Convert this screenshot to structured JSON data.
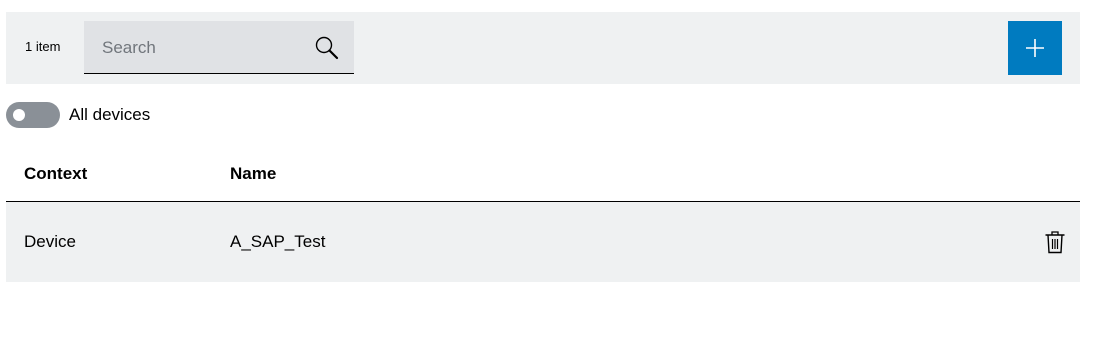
{
  "toolbar": {
    "item_count": "1 item",
    "search": {
      "placeholder": "Search",
      "value": "",
      "icon": "search-icon"
    },
    "add_button_icon": "plus-icon",
    "colors": {
      "toolbar_bg": "#eff1f2",
      "search_bg": "#e0e2e5",
      "accent": "#007bc0"
    }
  },
  "filter": {
    "toggle_label": "All devices",
    "toggle_on": false
  },
  "table": {
    "columns": [
      "Context",
      "Name"
    ],
    "rows": [
      {
        "context": "Device",
        "name": "A_SAP_Test",
        "action_icon": "trash-icon"
      }
    ]
  }
}
